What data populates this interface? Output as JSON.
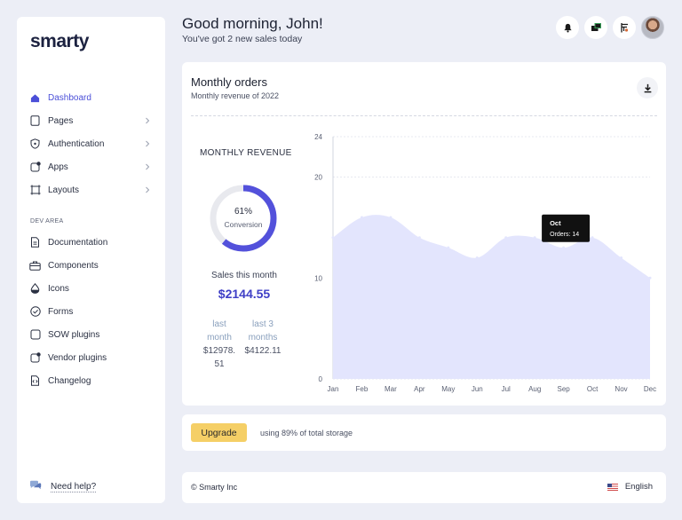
{
  "app": {
    "logo": "smarty"
  },
  "sidebar": {
    "main": [
      {
        "label": "Dashboard",
        "icon": "house-icon",
        "active": true,
        "chevron": false
      },
      {
        "label": "Pages",
        "icon": "page-icon",
        "chevron": true
      },
      {
        "label": "Authentication",
        "icon": "shield-icon",
        "chevron": true
      },
      {
        "label": "Apps",
        "icon": "apps-icon",
        "chevron": true
      },
      {
        "label": "Layouts",
        "icon": "layout-icon",
        "chevron": true
      }
    ],
    "section_title": "DEV AREA",
    "dev": [
      {
        "label": "Documentation",
        "icon": "document-icon"
      },
      {
        "label": "Components",
        "icon": "briefcase-icon"
      },
      {
        "label": "Icons",
        "icon": "drop-icon"
      },
      {
        "label": "Forms",
        "icon": "check-circle-icon"
      },
      {
        "label": "SOW plugins",
        "icon": "square-icon"
      },
      {
        "label": "Vendor plugins",
        "icon": "plugin-icon"
      },
      {
        "label": "Changelog",
        "icon": "code-file-icon"
      }
    ],
    "help": "Need help?"
  },
  "header": {
    "greeting": "Good morning, John!",
    "subtitle": "You've got 2 new sales today",
    "icons": [
      "bell-icon",
      "chat-icon",
      "flag-icon",
      "avatar"
    ]
  },
  "orders_card": {
    "title": "Monthly orders",
    "subtitle": "Monthly revenue of 2022",
    "revenue_title": "MONTHLY REVENUE",
    "conversion_pct": "61%",
    "conversion_label": "Conversion",
    "conversion_value": 0.61,
    "sales_label": "Sales this month",
    "sales_value": "$2144.55",
    "last_month_label_1": "last",
    "last_month_label_2": "month",
    "last_month_value_1": "$12978.",
    "last_month_value_2": "51",
    "last3_label_1": "last 3",
    "last3_label_2": "months",
    "last3_value": "$4122.11"
  },
  "chart_data": {
    "type": "area",
    "categories": [
      "Jan",
      "Feb",
      "Mar",
      "Apr",
      "May",
      "Jun",
      "Jul",
      "Aug",
      "Sep",
      "Oct",
      "Nov",
      "Dec"
    ],
    "series": [
      {
        "values": [
          14,
          16,
          16,
          14,
          13,
          12,
          14,
          14,
          13,
          14,
          12,
          10
        ]
      }
    ],
    "ylim": [
      0,
      24
    ],
    "yticks": [
      "0",
      "10",
      "20",
      "24"
    ],
    "grid": true,
    "tooltip": {
      "title": "Oct",
      "text": "Orders: 14"
    },
    "colors": {
      "fill": "#e3e5fd",
      "grid": "#dfe2ec"
    }
  },
  "upgrade": {
    "button": "Upgrade",
    "storage_text": "using 89% of total storage"
  },
  "footer": {
    "copyright": "© Smarty Inc",
    "language": "English"
  },
  "colors": {
    "accent": "#4b4fd8",
    "upgrade": "#f5cf66",
    "background": "#eceef6"
  }
}
